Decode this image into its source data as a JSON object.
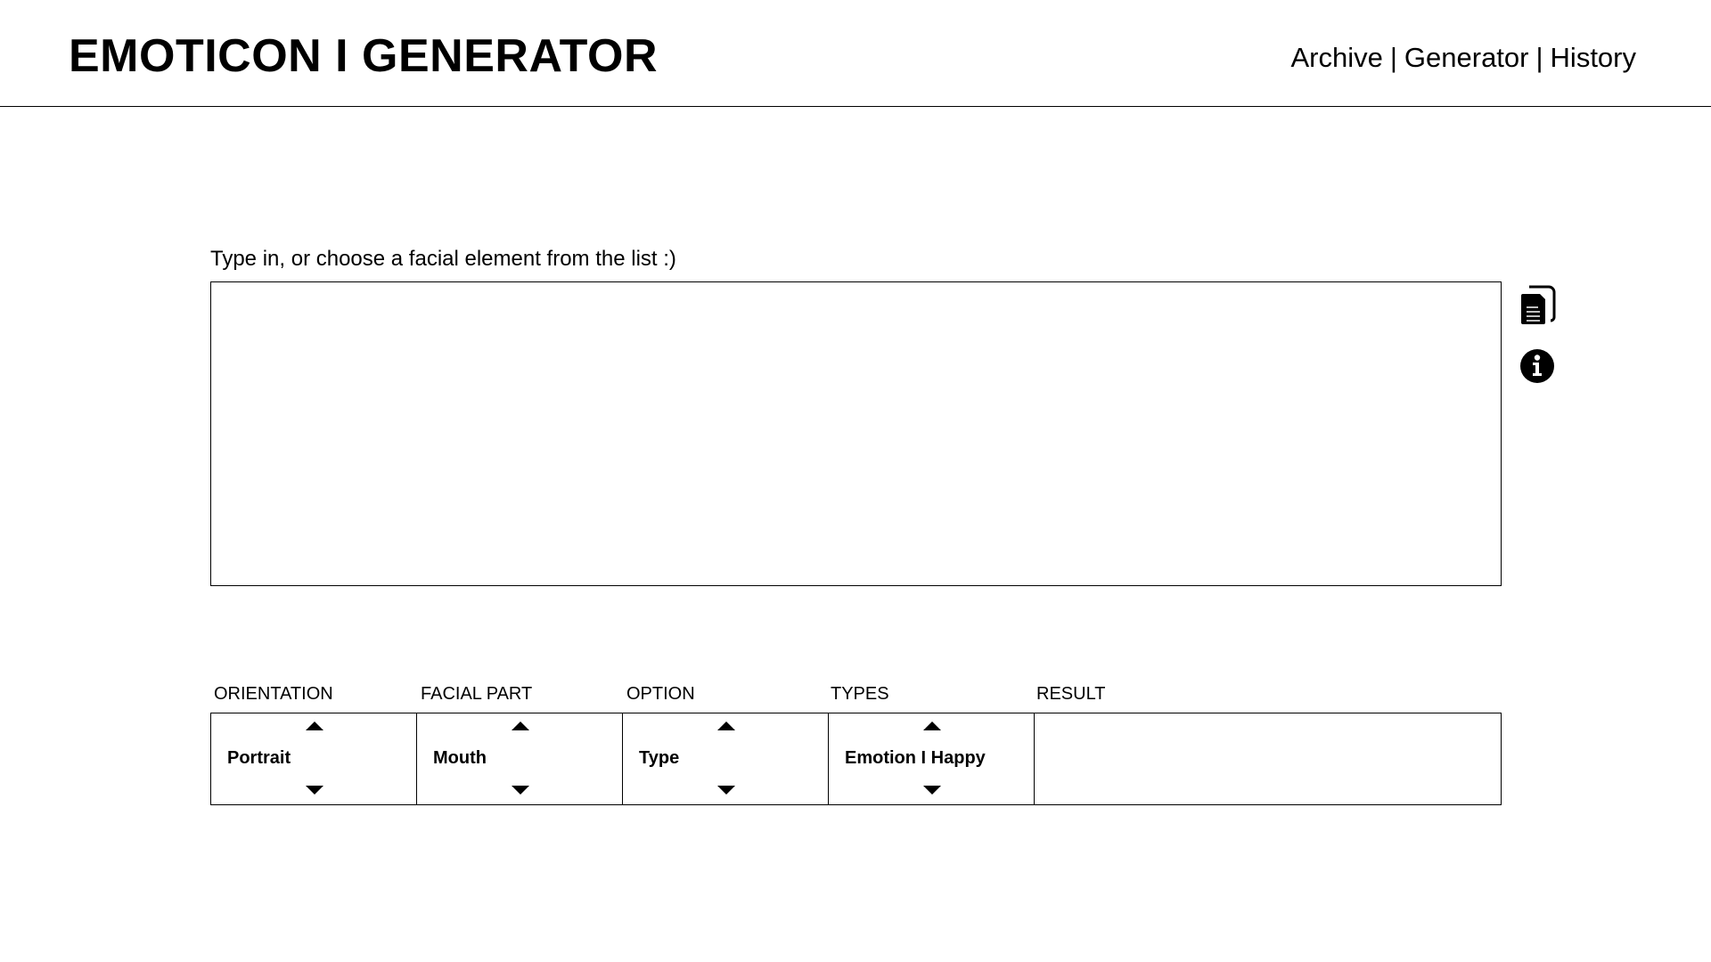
{
  "header": {
    "title": "EMOTICON I GENERATOR",
    "nav": [
      {
        "label": "Archive"
      },
      {
        "label": "Generator"
      },
      {
        "label": "History"
      }
    ],
    "separators": [
      "|",
      "|"
    ]
  },
  "editor": {
    "prompt": "Type in, or choose a facial element from the list :)",
    "value": "",
    "placeholder": ""
  },
  "icons": {
    "copy": "copy-documents-icon",
    "info": "info-circle-icon"
  },
  "selectors": {
    "labels": [
      "ORIENTATION",
      "FACIAL PART",
      "OPTION",
      "TYPES",
      "RESULT"
    ],
    "orientation": {
      "value": "Portrait"
    },
    "facial_part": {
      "value": "Mouth"
    },
    "option": {
      "value": "Type"
    },
    "types": {
      "value": "Emotion I Happy"
    },
    "result": {
      "value": ""
    }
  }
}
